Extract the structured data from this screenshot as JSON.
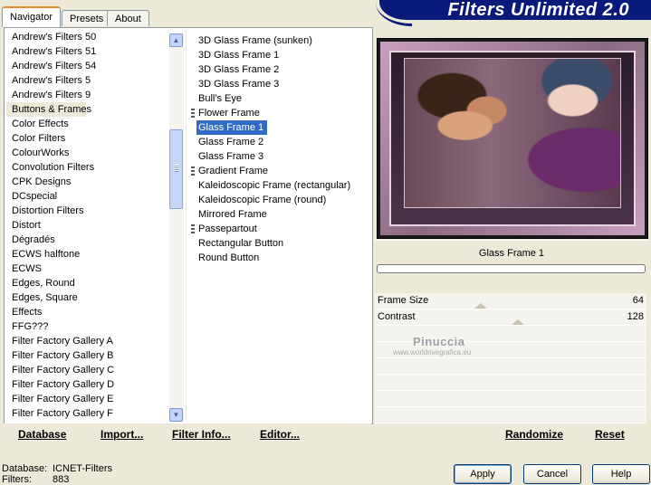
{
  "tabs": [
    "Navigator",
    "Presets",
    "About"
  ],
  "app_title": "Filters Unlimited 2.0",
  "categories": [
    "Andrew's Filters 50",
    "Andrew's Filters 51",
    "Andrew's Filters 54",
    "Andrew's Filters 5",
    "Andrew's Filters 9",
    "Buttons & Frames",
    "Color Effects",
    "Color Filters",
    "ColourWorks",
    "Convolution Filters",
    "CPK Designs",
    "DCspecial",
    "Distortion Filters",
    "Distort",
    "Dégradés",
    "ECWS halftone",
    "ECWS",
    "Edges, Round",
    "Edges, Square",
    "Effects",
    "FFG???",
    "Filter Factory Gallery A",
    "Filter Factory Gallery B",
    "Filter Factory Gallery C",
    "Filter Factory Gallery D",
    "Filter Factory Gallery E",
    "Filter Factory Gallery F"
  ],
  "selected_category": "Buttons & Frames",
  "filters": [
    {
      "label": "3D Glass Frame (sunken)",
      "group": false
    },
    {
      "label": "3D Glass Frame 1",
      "group": false
    },
    {
      "label": "3D Glass Frame 2",
      "group": false
    },
    {
      "label": "3D Glass Frame 3",
      "group": false
    },
    {
      "label": "Bull's Eye",
      "group": false
    },
    {
      "label": "Flower Frame",
      "group": true
    },
    {
      "label": "Glass Frame 1",
      "group": false
    },
    {
      "label": "Glass Frame 2",
      "group": false
    },
    {
      "label": "Glass Frame 3",
      "group": false
    },
    {
      "label": "Gradient Frame",
      "group": true
    },
    {
      "label": "Kaleidoscopic Frame (rectangular)",
      "group": false
    },
    {
      "label": "Kaleidoscopic Frame (round)",
      "group": false
    },
    {
      "label": "Mirrored Frame",
      "group": false
    },
    {
      "label": "Passepartout",
      "group": true
    },
    {
      "label": "Rectangular Button",
      "group": false
    },
    {
      "label": "Round Button",
      "group": false
    }
  ],
  "selected_filter": "Glass Frame 1",
  "bottom_buttons": {
    "database": "Database",
    "import": "Import...",
    "filter_info": "Filter Info...",
    "editor": "Editor...",
    "randomize": "Randomize",
    "reset": "Reset"
  },
  "preview_caption": "Glass Frame 1",
  "params": [
    {
      "label": "Frame Size",
      "value": "64",
      "level": 0.25
    },
    {
      "label": "Contrast",
      "value": "128",
      "level": 0.5
    }
  ],
  "watermark": {
    "name": "Pinuccia",
    "url": "www.worldrivegrafica.eu"
  },
  "status": {
    "database_label": "Database:",
    "database_value": "ICNET-Filters",
    "filters_label": "Filters:",
    "filters_value": "883"
  },
  "dialog_buttons": {
    "apply": "Apply",
    "cancel": "Cancel",
    "help": "Help"
  },
  "colors": {
    "selection": "#316ac5",
    "banner": "#0a1a7a",
    "tab_accent": "#e68b2c"
  }
}
